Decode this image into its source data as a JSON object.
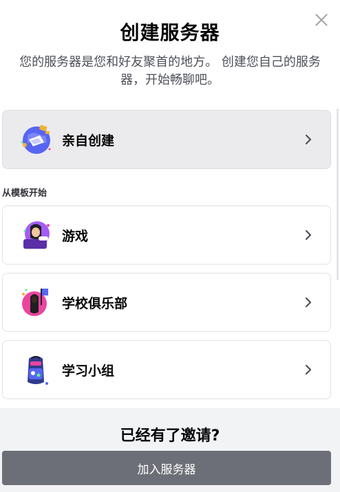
{
  "modal": {
    "title": "创建服务器",
    "subtitle_line1": "您的服务器是您和好友聚首的地方。 创建您自己的服务",
    "subtitle_line2": "器，开始畅聊吧。",
    "close_icon": "close-icon"
  },
  "options": {
    "create_own": {
      "label": "亲自创建",
      "icon": "globe-build-icon"
    },
    "section_label": "从模板开始",
    "templates": [
      {
        "label": "游戏",
        "icon": "gaming-icon"
      },
      {
        "label": "学校俱乐部",
        "icon": "school-club-icon"
      },
      {
        "label": "学习小组",
        "icon": "backpack-icon"
      }
    ]
  },
  "footer": {
    "title": "已经有了邀请?",
    "join_button_label": "加入服务器"
  },
  "colors": {
    "primary_option_bg": "#ebebed",
    "footer_bg": "#f2f3f5",
    "join_button_bg": "#6d6f78",
    "subtitle_text": "#4e5058"
  }
}
